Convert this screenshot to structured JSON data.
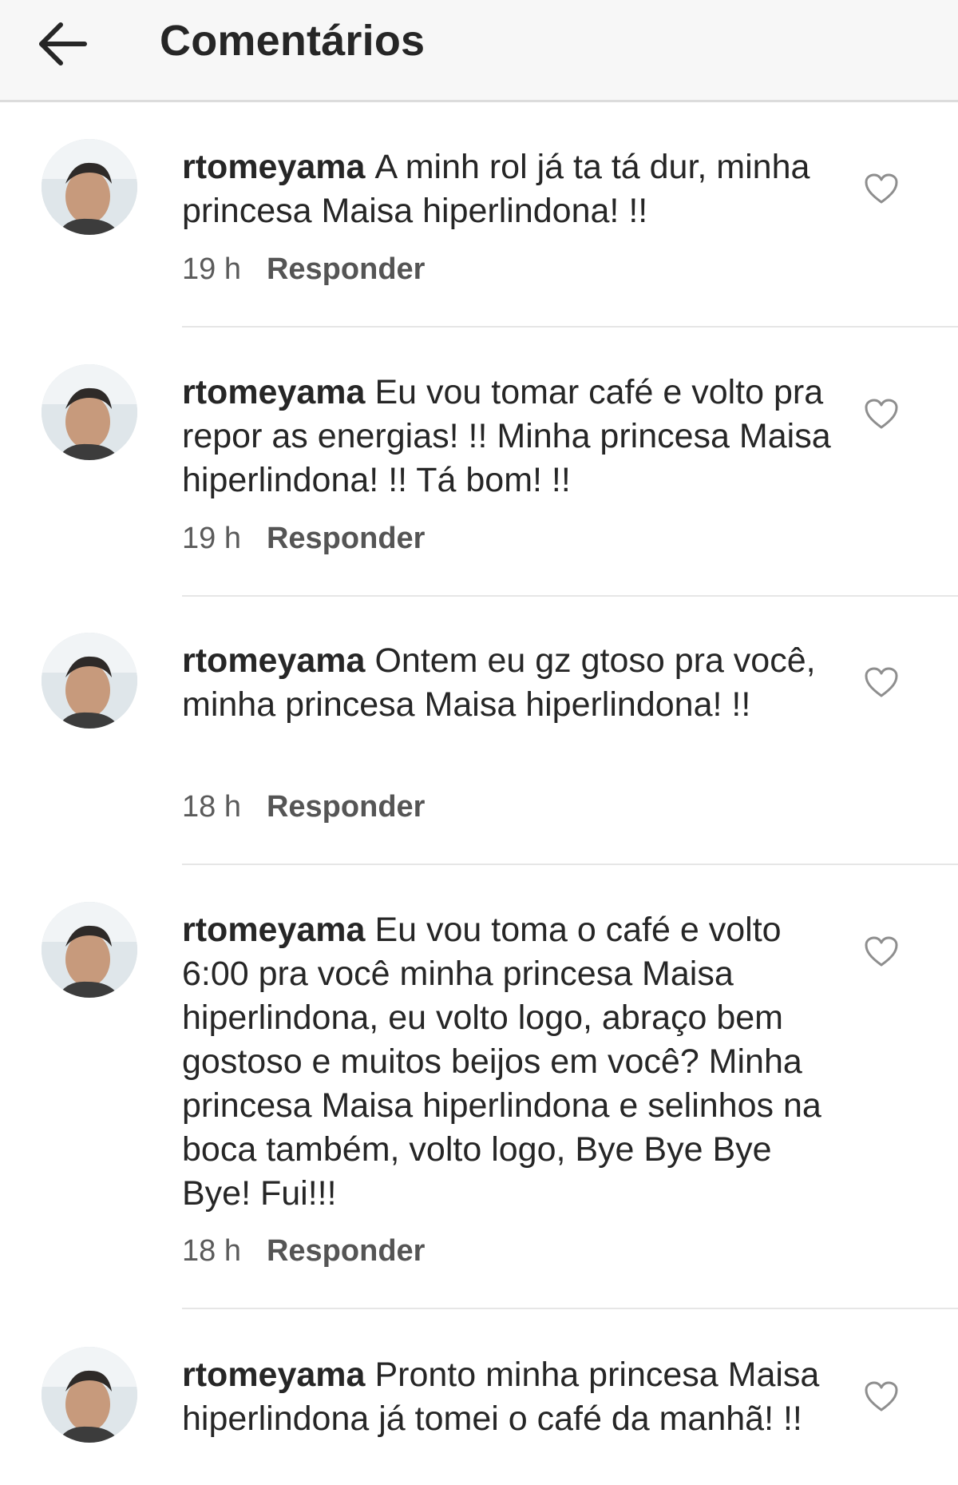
{
  "header": {
    "title": "Comentários",
    "back_icon": "arrow-left-icon"
  },
  "comments": [
    {
      "username": "rtomeyama",
      "text": "A minh rol já ta tá dur, minha princesa Maisa hiperlindona! !!",
      "time": "19 h",
      "reply_label": "Responder"
    },
    {
      "username": "rtomeyama",
      "text": "Eu vou tomar café e volto pra repor as energias! !! Minha princesa Maisa hiperlindona! !! Tá bom! !!",
      "time": "19 h",
      "reply_label": "Responder"
    },
    {
      "username": "rtomeyama",
      "text": "Ontem eu gz gtoso pra você, minha princesa Maisa hiperlindona! !!",
      "time": "18 h",
      "reply_label": "Responder"
    },
    {
      "username": "rtomeyama",
      "text": "Eu vou toma o café e volto 6:00 pra você minha princesa Maisa hiperlindona, eu volto logo, abraço bem gostoso e muitos beijos em você? Minha princesa Maisa hiperlindona e selinhos na boca também, volto logo, Bye Bye Bye Bye! Fui!!!",
      "time": "18 h",
      "reply_label": "Responder"
    },
    {
      "username": "rtomeyama",
      "text": "Pronto minha princesa Maisa hiperlindona já tomei o café da manhã! !!",
      "time": "",
      "reply_label": ""
    }
  ],
  "icons": {
    "like": "heart-outline-icon",
    "avatar": "user-avatar"
  },
  "colors": {
    "text": "#262626",
    "meta": "#5b5b5b",
    "header_bg": "#f7f7f7",
    "divider": "#e6e6e6"
  }
}
